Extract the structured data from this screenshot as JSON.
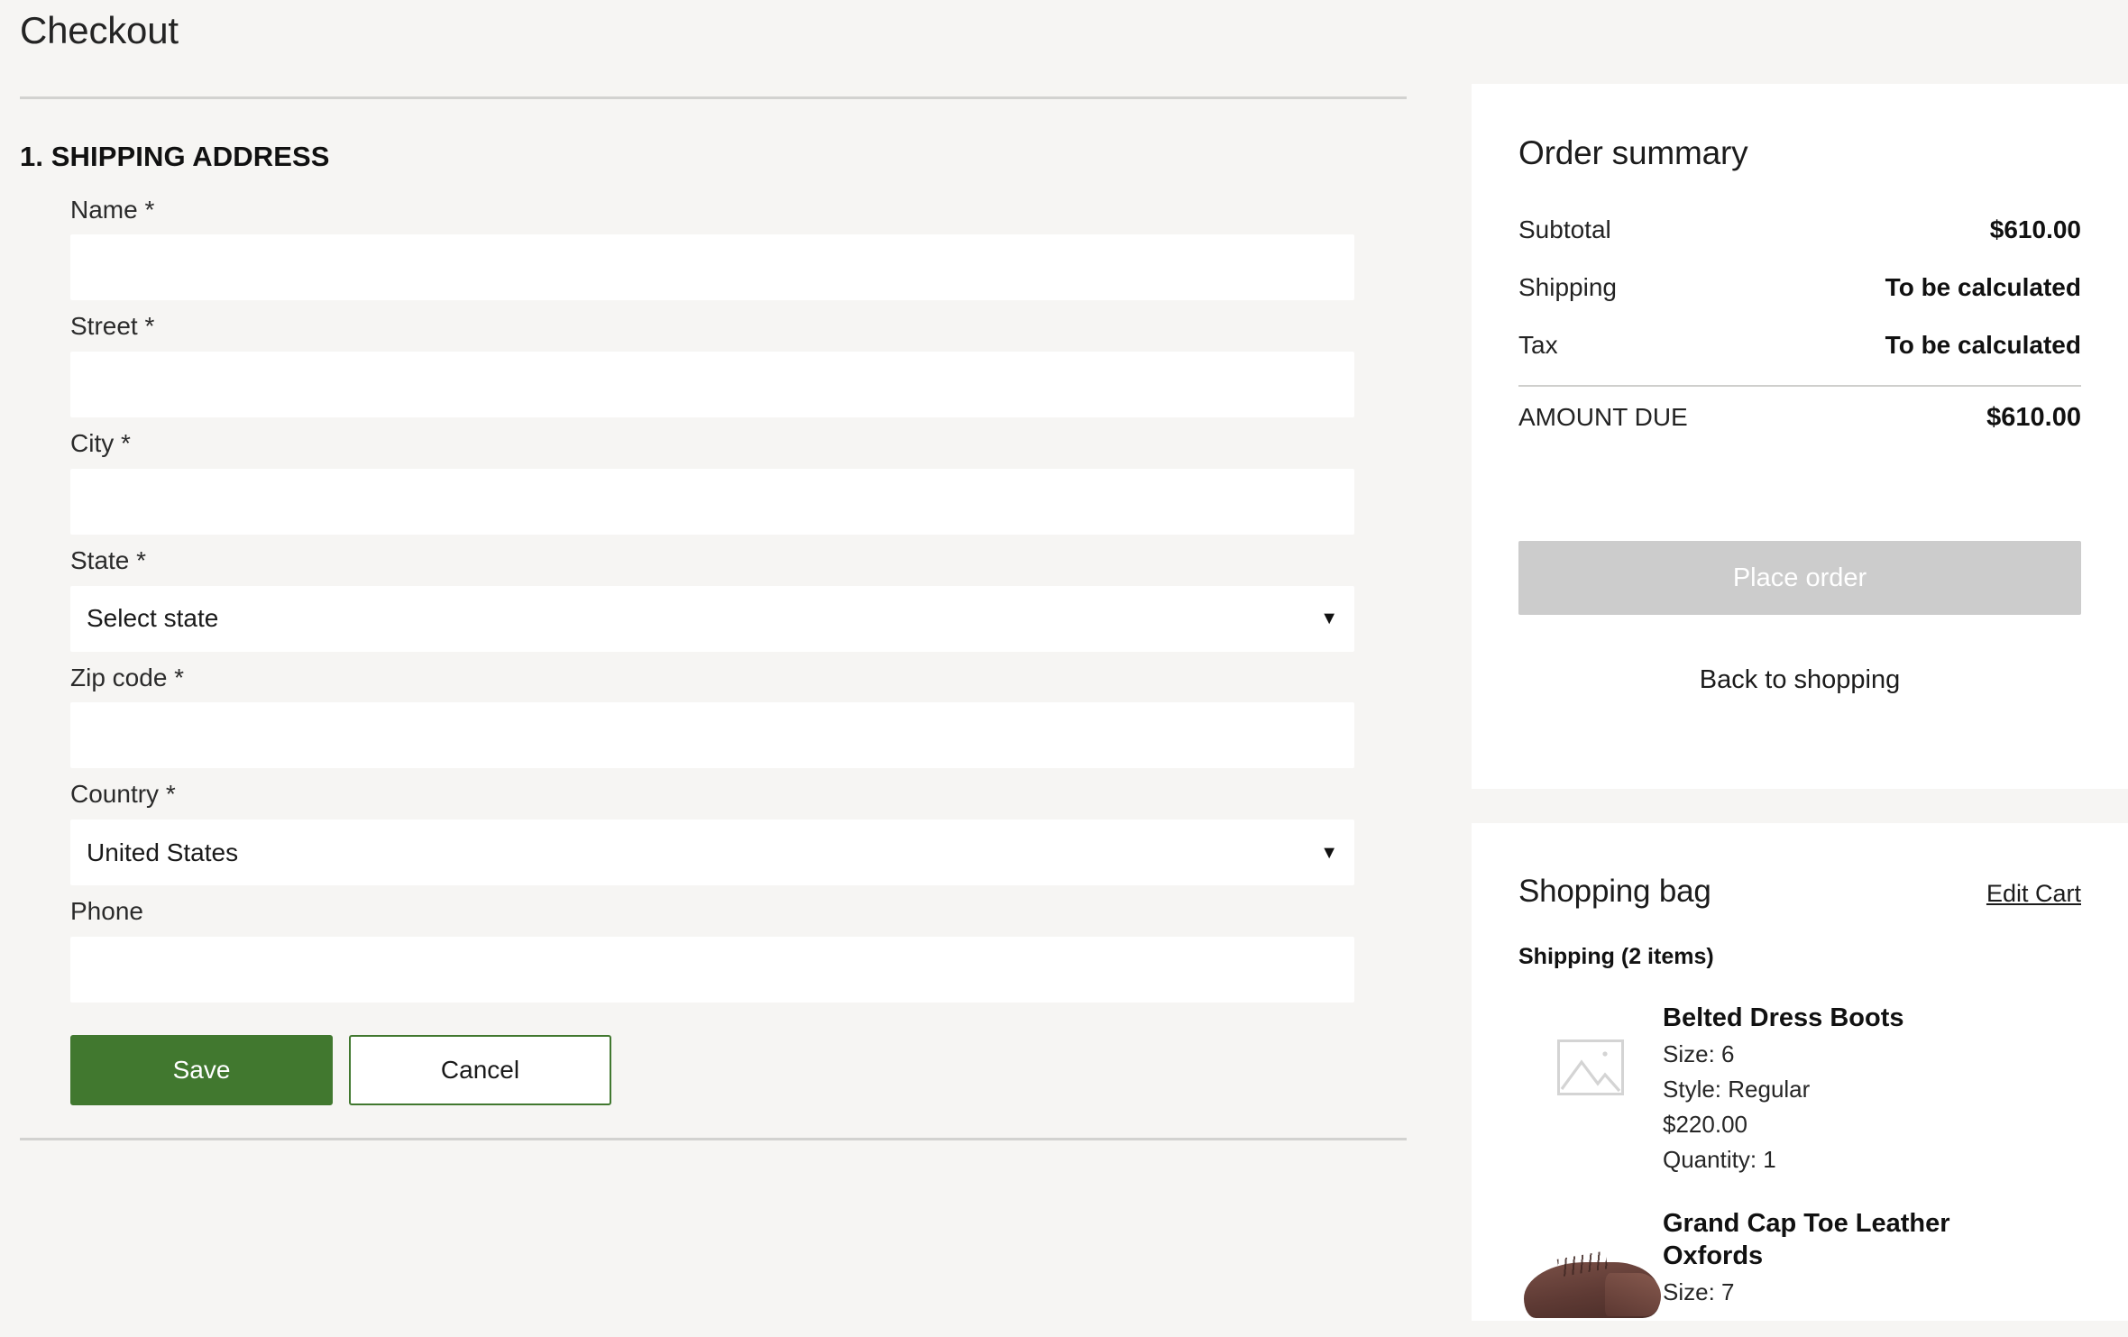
{
  "page": {
    "title": "Checkout"
  },
  "shipping_section": {
    "heading": "1. SHIPPING ADDRESS",
    "fields": [
      {
        "label": "Name *",
        "value": "",
        "placeholder": ""
      },
      {
        "label": "Street *",
        "value": "",
        "placeholder": ""
      },
      {
        "label": "City *",
        "value": "",
        "placeholder": ""
      },
      {
        "label": "Zip code *",
        "value": "",
        "placeholder": ""
      },
      {
        "label": "Phone",
        "value": "",
        "placeholder": ""
      }
    ],
    "state_field": {
      "label": "State *",
      "selected": "Select state",
      "caret": "▼"
    },
    "country_field": {
      "label": "Country *",
      "selected": "United States",
      "caret": "▼"
    },
    "save_label": "Save",
    "cancel_label": "Cancel"
  },
  "order_summary": {
    "title": "Order summary",
    "rows": [
      {
        "label": "Subtotal",
        "value": "$610.00"
      },
      {
        "label": "Shipping",
        "value": "To be calculated"
      },
      {
        "label": "Tax",
        "value": "To be calculated"
      }
    ],
    "amount_due": {
      "label": "AMOUNT DUE",
      "value": "$610.00"
    },
    "place_order_label": "Place order",
    "back_to_shopping_label": "Back to shopping"
  },
  "shopping_bag": {
    "title": "Shopping bag",
    "edit_cart_label": "Edit Cart",
    "group_label": "Shipping (2 items)",
    "items": [
      {
        "name": "Belted Dress Boots",
        "size": "Size: 6",
        "style": "Style: Regular",
        "price": "$220.00",
        "quantity": "Quantity: 1",
        "thumb": "image-placeholder-icon"
      },
      {
        "name": "Grand Cap Toe Leather Oxfords",
        "size": "Size: 7",
        "style": "",
        "price": "",
        "quantity": "",
        "thumb": "shoe-photo"
      }
    ]
  },
  "colors": {
    "page_background": "#f6f5f3",
    "card_background": "#ffffff",
    "save_green": "#41782f",
    "disabled_gray": "#cccccc",
    "divider": "#d2d2d0"
  }
}
